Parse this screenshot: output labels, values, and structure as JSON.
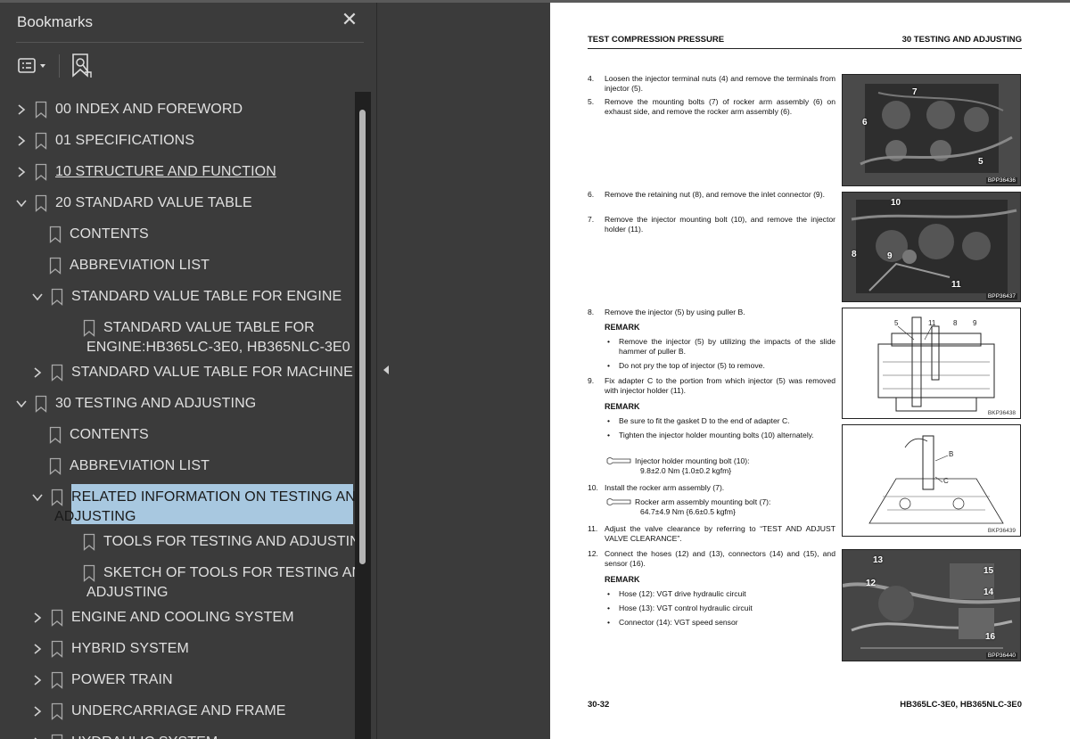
{
  "panel": {
    "title": "Bookmarks",
    "close_glyph": "✕",
    "options_icon": "bookmark-options-icon",
    "add_icon": "add-bookmark-icon"
  },
  "tree": [
    {
      "label": "00 INDEX AND FOREWORD",
      "level": 0,
      "state": "collapsed",
      "underline": false,
      "selected": false
    },
    {
      "label": "01 SPECIFICATIONS",
      "level": 0,
      "state": "collapsed",
      "underline": false,
      "selected": false
    },
    {
      "label": "10 STRUCTURE AND FUNCTION",
      "level": 0,
      "state": "collapsed",
      "underline": true,
      "selected": false
    },
    {
      "label": "20 STANDARD VALUE TABLE",
      "level": 0,
      "state": "expanded",
      "underline": false,
      "selected": false
    },
    {
      "label": "CONTENTS",
      "level": 1,
      "state": "leaf",
      "underline": false,
      "selected": false
    },
    {
      "label": "ABBREVIATION LIST",
      "level": 1,
      "state": "leaf",
      "underline": false,
      "selected": false
    },
    {
      "label": "STANDARD VALUE TABLE FOR ENGINE",
      "level": 1,
      "state": "expanded",
      "underline": false,
      "selected": false
    },
    {
      "label": "STANDARD VALUE TABLE FOR",
      "label2": "ENGINE:HB365LC-3E0, HB365NLC-3E0",
      "level": 2,
      "state": "leaf",
      "underline": false,
      "selected": false
    },
    {
      "label": "STANDARD VALUE TABLE FOR MACHINE",
      "level": 1,
      "state": "collapsed",
      "underline": false,
      "selected": false
    },
    {
      "label": "30 TESTING AND ADJUSTING",
      "level": 0,
      "state": "expanded",
      "underline": false,
      "selected": false
    },
    {
      "label": "CONTENTS",
      "level": 1,
      "state": "leaf",
      "underline": false,
      "selected": false
    },
    {
      "label": "ABBREVIATION LIST",
      "level": 1,
      "state": "leaf",
      "underline": false,
      "selected": false
    },
    {
      "label": "RELATED INFORMATION ON TESTING AND",
      "label2": "ADJUSTING",
      "level": 1,
      "state": "expanded",
      "underline": false,
      "selected": true
    },
    {
      "label": "TOOLS FOR TESTING AND ADJUSTING",
      "level": 2,
      "state": "leaf",
      "underline": false,
      "selected": false
    },
    {
      "label": "SKETCH OF TOOLS FOR TESTING AND",
      "label2": "ADJUSTING",
      "level": 2,
      "state": "leaf",
      "underline": false,
      "selected": false
    },
    {
      "label": "ENGINE AND COOLING SYSTEM",
      "level": 1,
      "state": "collapsed",
      "underline": false,
      "selected": false
    },
    {
      "label": "HYBRID SYSTEM",
      "level": 1,
      "state": "collapsed",
      "underline": false,
      "selected": false
    },
    {
      "label": "POWER TRAIN",
      "level": 1,
      "state": "collapsed",
      "underline": false,
      "selected": false
    },
    {
      "label": "UNDERCARRIAGE AND FRAME",
      "level": 1,
      "state": "collapsed",
      "underline": false,
      "selected": false
    },
    {
      "label": "HYDRAULIC SYSTEM",
      "level": 1,
      "state": "collapsed",
      "underline": false,
      "selected": false
    }
  ],
  "page": {
    "header_left": "TEST COMPRESSION PRESSURE",
    "header_right": "30 TESTING AND ADJUSTING",
    "footer_left": "30-32",
    "footer_right": "HB365LC-3E0, HB365NLC-3E0",
    "s4_n": "4.",
    "s4": "Loosen the injector terminal nuts (4) and remove the terminals from injector (5).",
    "s5_n": "5.",
    "s5": "Remove the mounting bolts (7) of rocker arm assembly (6) on exhaust side, and remove the rocker arm assembly (6).",
    "s6_n": "6.",
    "s6": "Remove the retaining nut (8), and remove the inlet connector (9).",
    "s7_n": "7.",
    "s7": "Remove the injector mounting bolt (10), and remove the injector holder (11).",
    "s8_n": "8.",
    "s8": "Remove the injector (5) by using puller B.",
    "remark": "REMARK",
    "s8_b1": "Remove the injector (5) by utilizing the impacts of the slide hammer of puller B.",
    "s8_b2": "Do not pry the top of injector (5) to remove.",
    "s9_n": "9.",
    "s9": "Fix adapter C to the portion from which injector (5) was removed with injector holder (11).",
    "s9_b1": "Be sure to fit the gasket D to the end of adapter C.",
    "s9_b2": "Tighten the injector holder mounting bolts (10) alternately.",
    "t1_a": "Injector holder mounting bolt (10):",
    "t1_b": "9.8±2.0 Nm {1.0±0.2 kgfm}",
    "s10_n": "10.",
    "s10": "Install the rocker arm assembly (7).",
    "t2_a": "Rocker arm assembly mounting bolt (7):",
    "t2_b": "64.7±4.9 Nm {6.6±0.5 kgfm}",
    "s11_n": "11.",
    "s11": "Adjust the valve clearance by referring to “TEST AND ADJUST VALVE CLEARANCE”.",
    "s12_n": "12.",
    "s12": "Connect the hoses (12) and (13), connectors (14) and (15), and sensor (16).",
    "s12_b1": "Hose (12): VGT drive hydraulic circuit",
    "s12_b2": "Hose (13): VGT control hydraulic circuit",
    "s12_b3": "Connector (14): VGT speed sensor",
    "bullet_glyph": "•",
    "fig1_code": "BPP36436",
    "fig1_l7": "7",
    "fig1_l6": "6",
    "fig1_l5": "5",
    "fig2_code": "BPP36437",
    "fig2_l10": "10",
    "fig2_l8": "8",
    "fig2_l9": "9",
    "fig2_l11": "11",
    "fig3_code": "BKP36438",
    "fig3_l5": "5",
    "fig3_l11": "11",
    "fig3_l8": "8",
    "fig3_l9": "9",
    "fig4_code": "BKP36439",
    "fig4_lB": "B",
    "fig4_lC": "C",
    "fig5_code": "BPP36440",
    "fig5_l13": "13",
    "fig5_l12": "12",
    "fig5_l15": "15",
    "fig5_l14": "14",
    "fig5_l16": "16"
  }
}
